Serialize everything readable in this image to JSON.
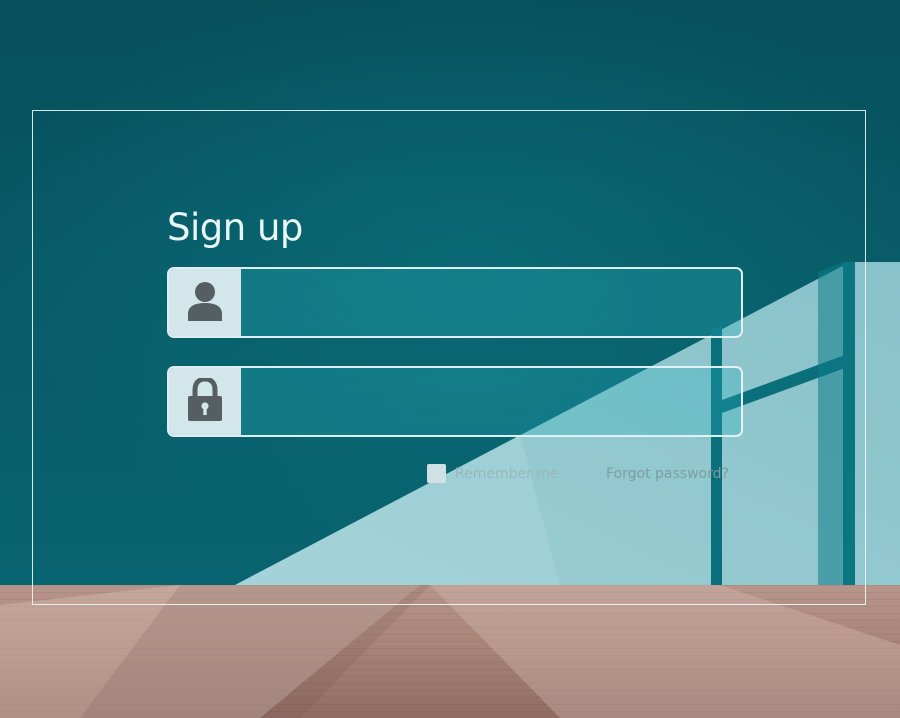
{
  "form": {
    "title": "Sign up",
    "username": {
      "icon": "user-icon",
      "value": "",
      "placeholder": ""
    },
    "password": {
      "icon": "lock-icon",
      "value": "",
      "placeholder": ""
    },
    "remember_label": "Remember me",
    "remember_checked": false,
    "forgot_label": "Forgot password?"
  },
  "colors": {
    "wall": "#06535e",
    "panel_border": "#ebf8fa",
    "icon_box": "#d3e6e9",
    "icon_glyph": "#555f62",
    "text": "#e7f6f7",
    "muted_text": "#9ab7bb"
  }
}
